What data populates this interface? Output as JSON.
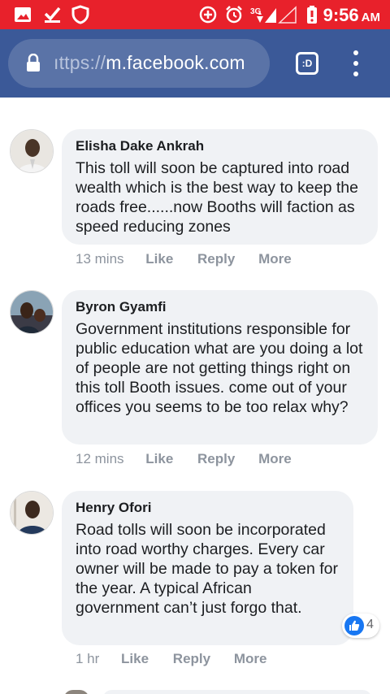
{
  "status_bar": {
    "time": "9:56",
    "ampm": "AM",
    "network": "3G",
    "icons": [
      "image-icon",
      "check-download-icon",
      "shield-icon",
      "add-circle-icon",
      "alarm-icon",
      "signal-icon",
      "battery-low-icon"
    ]
  },
  "browser": {
    "url_prefix": "ıttps://",
    "url_domain": "m.facebook.com",
    "tab_label": ":D",
    "colors": {
      "bar": "#3b5998",
      "status": "#e8212b"
    }
  },
  "comments": [
    {
      "author": "Elisha Dake Ankrah",
      "text": "This toll will soon be captured into road wealth which is the best way to keep the roads free......now Booths will faction as speed reducing zones",
      "time": "13 mins",
      "like": "Like",
      "reply": "Reply",
      "more": "More"
    },
    {
      "author": "Byron Gyamfi",
      "text": "Government institutions responsible for public education what are you doing a lot of people are not getting things right on this toll Booth issues. come out of your offices you seems to be too relax why?",
      "time": "12 mins",
      "like": "Like",
      "reply": "Reply",
      "more": "More"
    },
    {
      "author": "Henry Ofori",
      "text": "Road tolls will soon be incorporated into road worthy charges. Every car owner will be made to pay a token for the year. A typical African government can’t just forgo that.",
      "time": "1 hr",
      "like": "Like",
      "reply": "Reply",
      "more": "More",
      "reaction_count": "4"
    }
  ]
}
